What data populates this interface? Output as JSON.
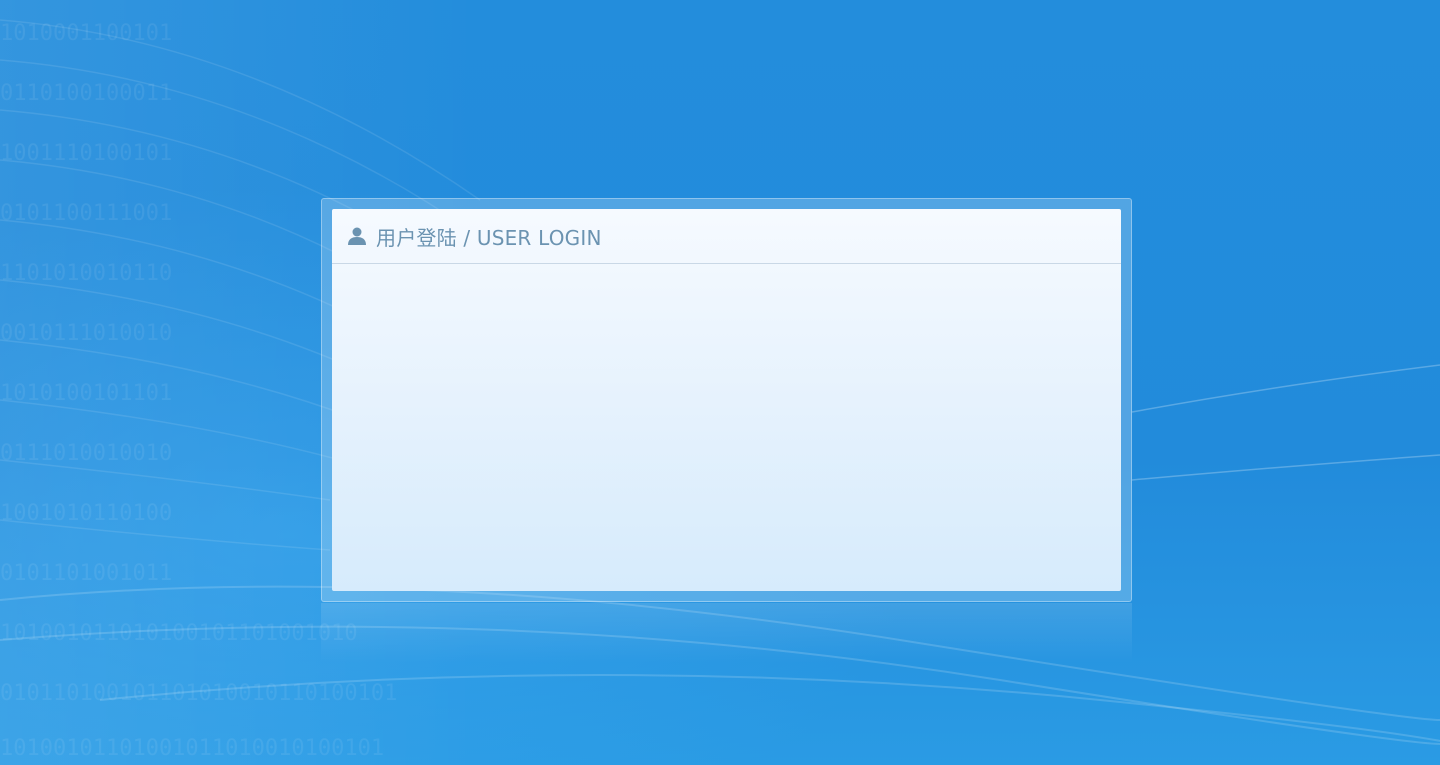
{
  "login": {
    "title": "用户登陆 / USER LOGIN",
    "header_icon": "user-icon"
  },
  "colors": {
    "background": "#238cdc",
    "panel_top": "#f6faff",
    "panel_bottom": "#d6ebfc",
    "title_text": "#6b93b1"
  }
}
